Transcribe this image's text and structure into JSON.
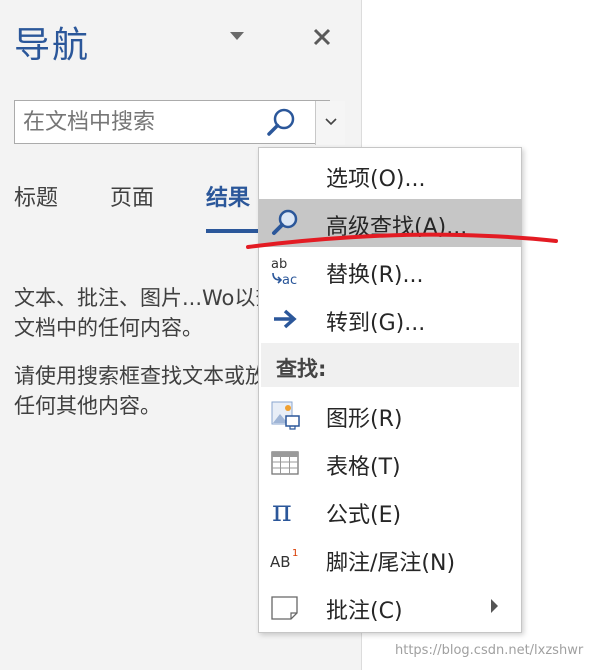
{
  "pane": {
    "title": "导航",
    "search": {
      "placeholder": "在文档中搜索"
    },
    "tabs": [
      {
        "label": "标题",
        "active": false
      },
      {
        "label": "页面",
        "active": false
      },
      {
        "label": "结果",
        "active": true
      }
    ],
    "paragraphs": [
      "文本、批注、图片...Wo以查找您的文档中的任何内容。",
      "请使用搜索框查找文本或放大镜查找任何其他内容。"
    ]
  },
  "menu": {
    "items": [
      {
        "label": "选项(O)...",
        "icon": "none"
      },
      {
        "label": "高级查找(A)...",
        "icon": "magnifier-icon",
        "highlighted": true
      },
      {
        "label": "替换(R)...",
        "icon": "replace-icon",
        "icon_text_top": "ab",
        "icon_text_bottom": "ac"
      },
      {
        "label": "转到(G)...",
        "icon": "arrow-right-icon"
      }
    ],
    "section_label": "查找:",
    "find_items": [
      {
        "label": "图形(R)",
        "icon": "graphics-icon"
      },
      {
        "label": "表格(T)",
        "icon": "table-icon"
      },
      {
        "label": "公式(E)",
        "icon": "pi-icon",
        "glyph": "π"
      },
      {
        "label": "脚注/尾注(N)",
        "icon": "footnote-icon",
        "glyph": "AB",
        "superscript": "1"
      },
      {
        "label": "批注(C)",
        "icon": "comment-icon",
        "has_submenu": true
      }
    ]
  },
  "colors": {
    "accent": "#2b579a",
    "highlight": "#c6c6c6",
    "annotation": "#e31b23"
  },
  "watermark": "https://blog.csdn.net/lxzshwr"
}
